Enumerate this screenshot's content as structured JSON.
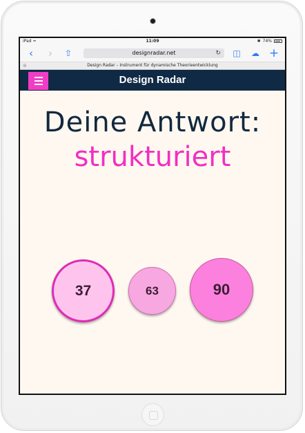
{
  "status_bar": {
    "carrier": "iPad",
    "time": "11:09",
    "battery": "74%"
  },
  "browser": {
    "url": "designradar.net",
    "tab_title": "Design Radar – Instrument für dynamische Theorieentwicklung"
  },
  "app": {
    "title": "Design Radar"
  },
  "content": {
    "heading": "Deine Antwort:",
    "answer": "strukturiert",
    "options": [
      "37",
      "63",
      "90"
    ]
  },
  "colors": {
    "header_bg": "#102a45",
    "accent": "#f13dc6",
    "page_bg": "#fef8f0"
  }
}
